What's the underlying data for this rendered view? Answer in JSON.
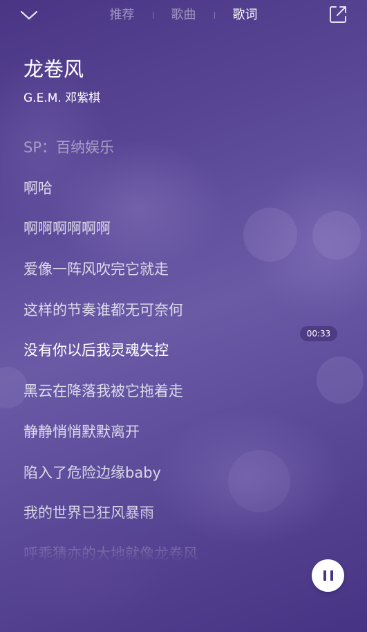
{
  "header": {
    "tabs": [
      {
        "label": "推荐",
        "active": false
      },
      {
        "label": "歌曲",
        "active": false
      },
      {
        "label": "歌词",
        "active": true
      }
    ],
    "back_icon": "chevron-down-icon",
    "share_icon": "share-external-icon"
  },
  "song": {
    "title": "龙卷风",
    "artist": "G.E.M. 邓紫棋"
  },
  "lyrics": {
    "lines": [
      "SP：百纳娱乐",
      "啊哈",
      "啊啊啊啊啊啊",
      "爱像一阵风吹完它就走",
      "这样的节奏谁都无可奈何",
      "没有你以后我灵魂失控",
      "黑云在降落我被它拖着走",
      "静静悄悄默默离开",
      "陷入了危险边缘baby",
      "我的世界已狂风暴雨",
      "呼乖猜亦的大地就像龙卷风"
    ],
    "current_index": 5,
    "current_time": "00:33"
  },
  "player": {
    "state": "playing",
    "pause_icon": "pause-icon"
  },
  "colors": {
    "background": "#553f90",
    "accent": "#4a3585",
    "text": "#ffffff"
  }
}
